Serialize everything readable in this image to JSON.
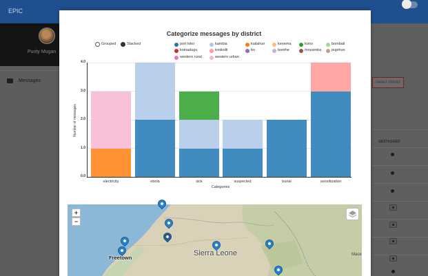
{
  "app": {
    "title": "EPIC",
    "user_name": "Purity Mugan",
    "sidebar_menu_label": "Messages",
    "bg_select_text": "Select district",
    "bg_column_header": "GESTAGGED",
    "accent_color": "#1f4f8f"
  },
  "modal": {
    "view_options": {
      "grouped_label": "Grouped",
      "stacked_label": "Stacked",
      "selected": "stacked"
    }
  },
  "chart_data": {
    "type": "bar",
    "stacked": true,
    "title": "Categorize messages by district",
    "xlabel": "Categories",
    "ylabel": "Number of messages",
    "ylim": [
      0,
      4
    ],
    "yticks": [
      "0.0",
      "1.0",
      "2.0",
      "3.0",
      "4.0"
    ],
    "categories": [
      "electricity",
      "ebola",
      "sick",
      "suspected",
      "burial",
      "sensitization"
    ],
    "legend_position": "top-right",
    "legend": [
      {
        "name": "port loko",
        "color": "#1f77b4"
      },
      {
        "name": "kambia",
        "color": "#aec7e8"
      },
      {
        "name": "kenema",
        "color": "#ffbb78"
      },
      {
        "name": "kono",
        "color": "#2ca02c"
      },
      {
        "name": "bombali",
        "color": "#98df8a"
      },
      {
        "name": "koinadugu",
        "color": "#d62728"
      },
      {
        "name": "tonkolili",
        "color": "#ff9896"
      },
      {
        "name": "kailahun",
        "color": "#ff7f0e"
      },
      {
        "name": "bo",
        "color": "#9467bd"
      },
      {
        "name": "bonthe",
        "color": "#c5b0d5"
      },
      {
        "name": "moyamba",
        "color": "#8c564b"
      },
      {
        "name": "pujehun",
        "color": "#c49c94"
      },
      {
        "name": "western rural",
        "color": "#e377c2"
      },
      {
        "name": "western urban",
        "color": "#f7b6d2"
      }
    ],
    "series": [
      {
        "name": "port loko",
        "color": "#1f77b4",
        "values": [
          0,
          2,
          1,
          1,
          2,
          3
        ]
      },
      {
        "name": "kambia",
        "color": "#aec7e8",
        "values": [
          0,
          2,
          1,
          1,
          0,
          0
        ]
      },
      {
        "name": "kailahun",
        "color": "#ff7f0e",
        "values": [
          1,
          0,
          0,
          0,
          0,
          0
        ]
      },
      {
        "name": "kono",
        "color": "#2ca02c",
        "values": [
          0,
          0,
          1,
          0,
          0,
          0
        ]
      },
      {
        "name": "tonkolili",
        "color": "#ff9896",
        "values": [
          0,
          0,
          0,
          0,
          0,
          1
        ]
      },
      {
        "name": "western urban",
        "color": "#f7b6d2",
        "values": [
          2,
          0,
          0,
          0,
          0,
          0
        ]
      }
    ]
  },
  "map": {
    "country_label": "Sierra Leone",
    "city_label": "Freetown",
    "edge_label": "Mace",
    "zoom_in": "+",
    "zoom_out": "−"
  }
}
